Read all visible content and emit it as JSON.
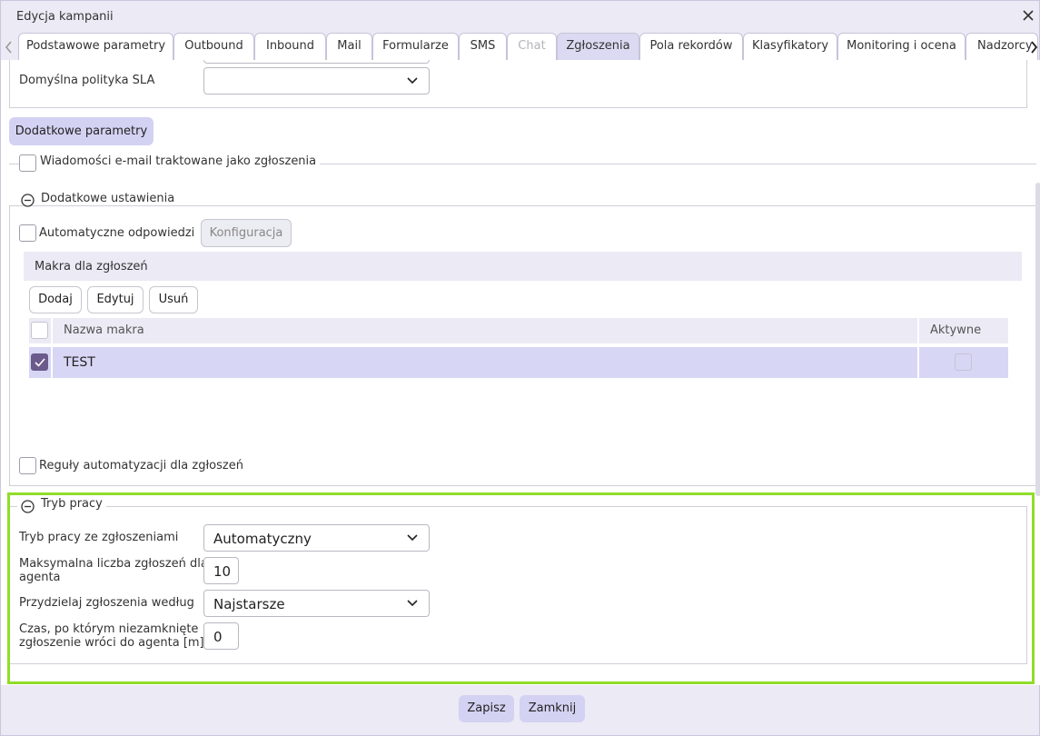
{
  "window": {
    "title": "Edycja kampanii"
  },
  "tabs": [
    {
      "label": "Podstawowe parametry",
      "state": "normal"
    },
    {
      "label": "Outbound",
      "state": "normal"
    },
    {
      "label": "Inbound",
      "state": "normal"
    },
    {
      "label": "Mail",
      "state": "normal"
    },
    {
      "label": "Formularze",
      "state": "normal"
    },
    {
      "label": "SMS",
      "state": "normal"
    },
    {
      "label": "Chat",
      "state": "disabled"
    },
    {
      "label": "Zgłoszenia",
      "state": "active"
    },
    {
      "label": "Pola rekordów",
      "state": "normal"
    },
    {
      "label": "Klasyfikatory",
      "state": "normal"
    },
    {
      "label": "Monitoring i ocena",
      "state": "normal"
    },
    {
      "label": "Nadzorcy",
      "state": "normal"
    }
  ],
  "sla": {
    "label": "Domyślna polityka SLA",
    "value": ""
  },
  "extra_params_button": "Dodatkowe parametry",
  "email_as_tickets": {
    "label": "Wiadomości e-mail traktowane jako zgłoszenia",
    "checked": false
  },
  "additional_settings": {
    "legend": "Dodatkowe ustawienia",
    "auto_replies": {
      "label": "Automatyczne odpowiedzi",
      "checked": false
    },
    "config_button": "Konfiguracja",
    "macros": {
      "header": "Makra dla zgłoszeń",
      "add_button": "Dodaj",
      "edit_button": "Edytuj",
      "delete_button": "Usuń",
      "columns": {
        "name": "Nazwa makra",
        "active": "Aktywne"
      },
      "rows": [
        {
          "name": "TEST",
          "selected": true,
          "active": false
        }
      ]
    },
    "automation_rules": {
      "label": "Reguły automatyzacji dla zgłoszeń",
      "checked": false
    }
  },
  "work_mode": {
    "legend": "Tryb pracy",
    "mode": {
      "label": "Tryb pracy ze zgłoszeniami",
      "value": "Automatyczny"
    },
    "max_tickets": {
      "label_line1": "Maksymalna liczba zgłoszeń dla",
      "label_line2": "agenta",
      "value": "10"
    },
    "assign_by": {
      "label": "Przydzielaj zgłoszenia według",
      "value": "Najstarsze"
    },
    "return_time": {
      "label_line1": "Czas, po którym niezamknięte",
      "label_line2": "zgłoszenie wróci do agenta [m]",
      "value": "0"
    }
  },
  "footer": {
    "save": "Zapisz",
    "close": "Zamknij"
  },
  "colors": {
    "accent": "#d3d2f3",
    "checked": "#6b5a8c",
    "highlight": "#90dd2a",
    "row_selected": "#d7d6f5"
  }
}
